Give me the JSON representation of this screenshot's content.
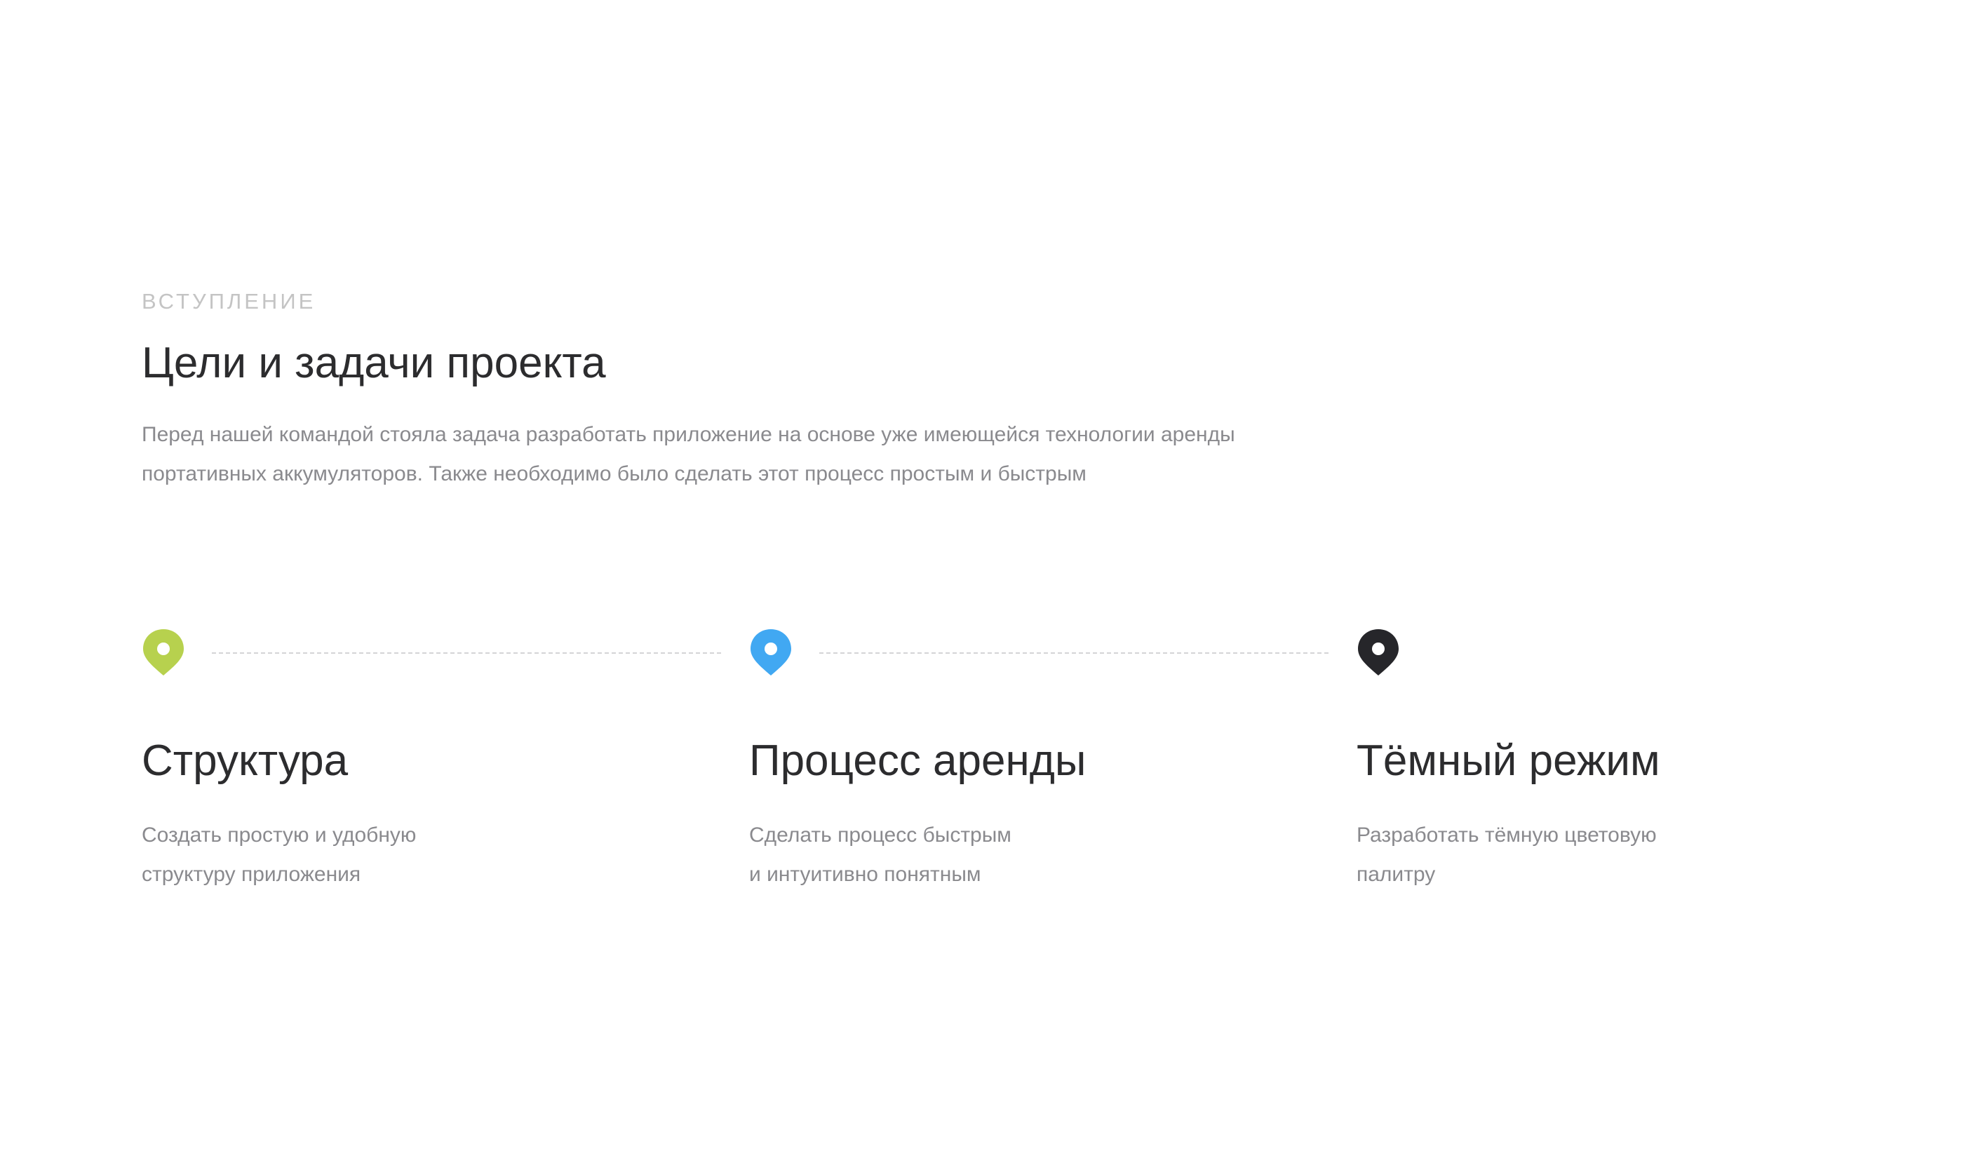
{
  "intro": {
    "eyebrow": "ВСТУПЛЕНИЕ",
    "title": "Цели и задачи проекта",
    "description": "Перед нашей командой стояла задача разработать приложение на основе уже имеющейся технологии аренды портативных аккумуляторов. Также необходимо было сделать этот процесс простым и быстрым"
  },
  "steps": [
    {
      "icon": "map-pin-icon",
      "color": "#B7D14E",
      "title": "Структура",
      "description": "Создать простую и удобную\nструктуру приложения"
    },
    {
      "icon": "map-pin-icon",
      "color": "#41A8F2",
      "title": "Процесс аренды",
      "description": "Сделать процесс быстрым\nи интуитивно понятным"
    },
    {
      "icon": "map-pin-icon",
      "color": "#26262A",
      "title": "Тёмный режим",
      "description": "Разработать тёмную цветовую\nпалитру"
    }
  ]
}
